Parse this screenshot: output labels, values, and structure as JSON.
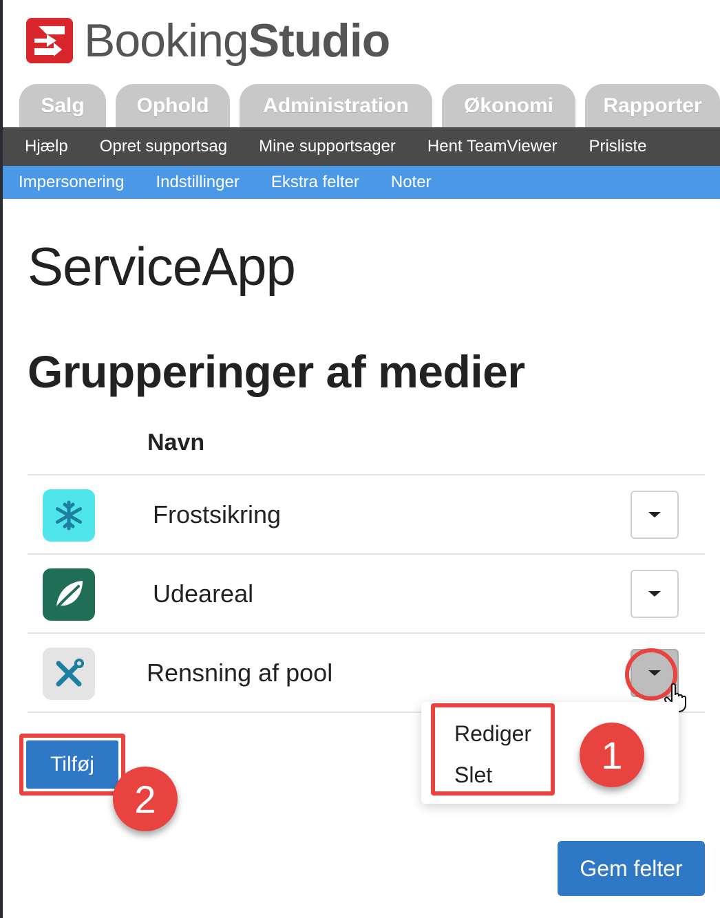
{
  "app": {
    "logo_regular": "Booking",
    "logo_bold": "Studio",
    "brand_color": "#d9262c"
  },
  "tabs": [
    {
      "label": "Salg"
    },
    {
      "label": "Ophold"
    },
    {
      "label": "Administration"
    },
    {
      "label": "Økonomi"
    },
    {
      "label": "Rapporter"
    }
  ],
  "subnav": [
    {
      "label": "Hjælp"
    },
    {
      "label": "Opret supportsag"
    },
    {
      "label": "Mine supportsager"
    },
    {
      "label": "Hent TeamViewer"
    },
    {
      "label": "Prisliste"
    }
  ],
  "bluenav": [
    {
      "label": "Impersonering"
    },
    {
      "label": "Indstillinger"
    },
    {
      "label": "Ekstra felter"
    },
    {
      "label": "Noter"
    }
  ],
  "page": {
    "title": "ServiceApp",
    "section_title": "Grupperinger af medier"
  },
  "table": {
    "header_name": "Navn",
    "rows": [
      {
        "name": "Frostsikring",
        "icon": "snowflake-icon",
        "icon_bg": "#4ee6ea"
      },
      {
        "name": "Udeareal",
        "icon": "leaf-icon",
        "icon_bg": "#1f6e55"
      },
      {
        "name": "Rensning af pool",
        "icon": "tools-icon",
        "icon_bg": "#e4e4e4"
      }
    ]
  },
  "dropdown_menu": {
    "items": [
      {
        "label": "Rediger"
      },
      {
        "label": "Slet"
      }
    ]
  },
  "annotations": {
    "badge_1": "1",
    "badge_2": "2",
    "color": "#e8433f"
  },
  "buttons": {
    "add_label": "Tilføj",
    "save_label": "Gem felter",
    "primary_color": "#2f78c6"
  }
}
